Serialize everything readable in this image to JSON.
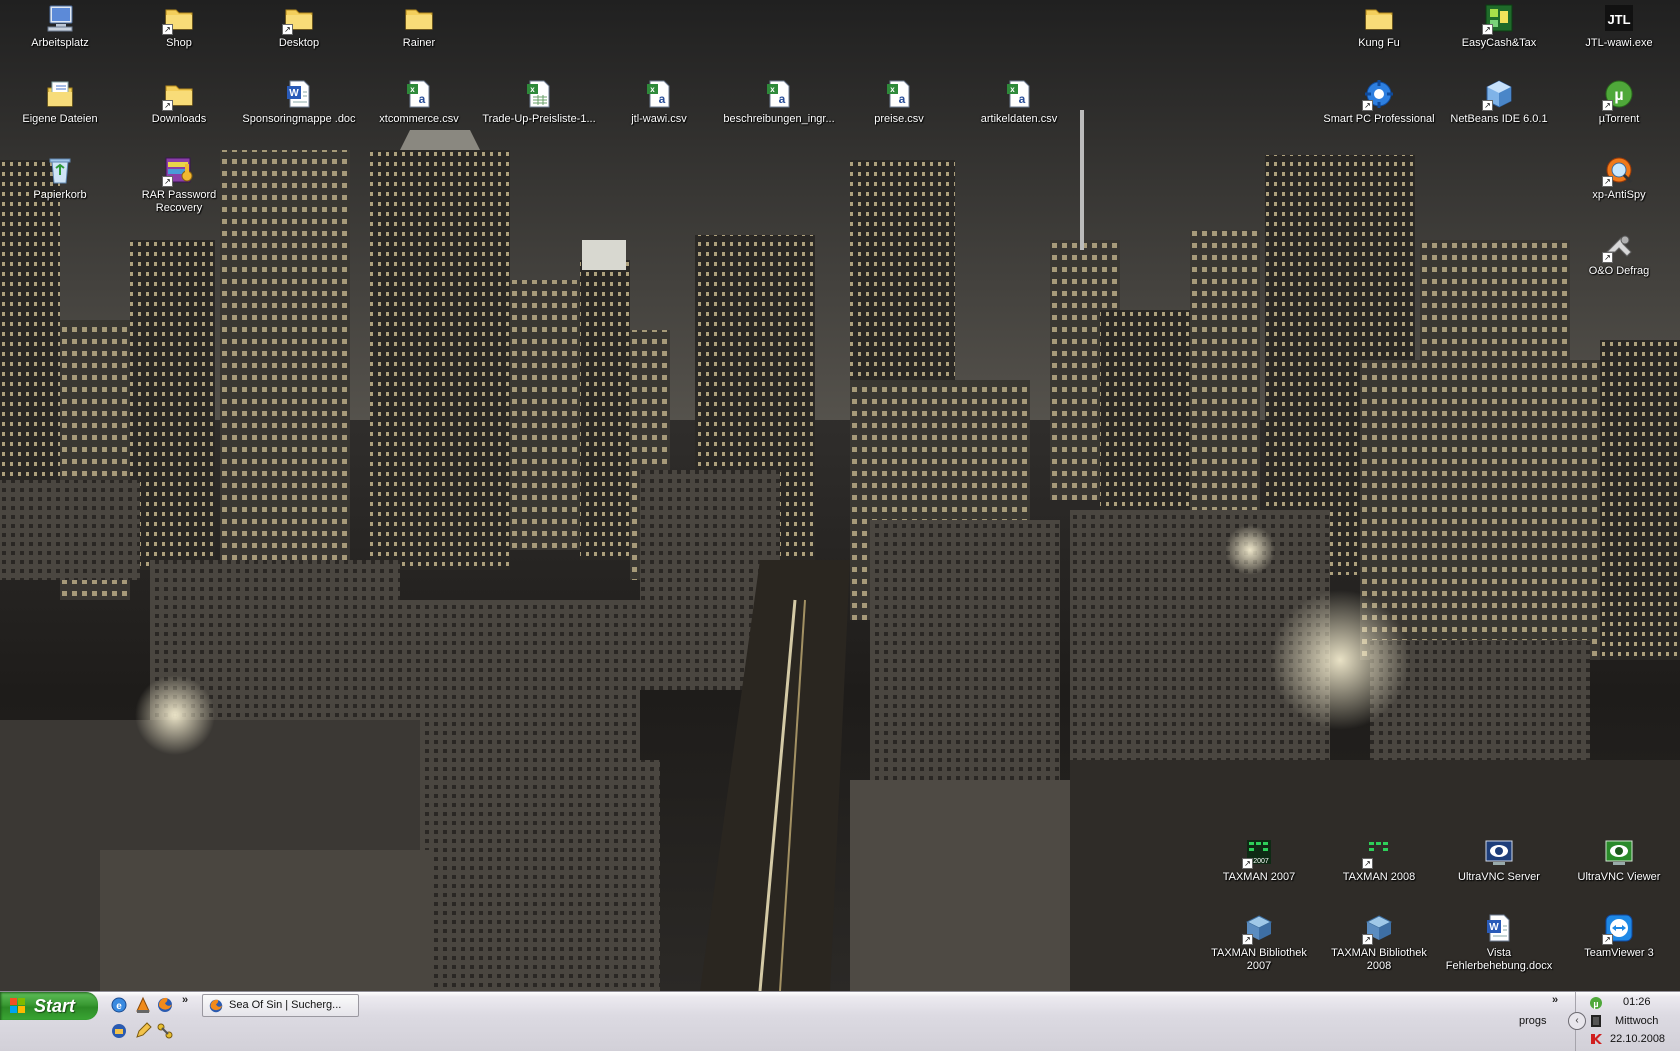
{
  "desktop": {
    "icons": [
      {
        "label": "Arbeitsplatz",
        "icon": "my-computer-icon"
      },
      {
        "label": "Shop",
        "icon": "folder-icon"
      },
      {
        "label": "Desktop",
        "icon": "folder-icon"
      },
      {
        "label": "Rainer",
        "icon": "folder-icon"
      },
      {
        "label": "Kung Fu",
        "icon": "folder-icon"
      },
      {
        "label": "EasyCash&Tax",
        "icon": "easycash-icon"
      },
      {
        "label": "JTL-wawi.exe",
        "icon": "jtl-icon"
      },
      {
        "label": "Eigene Dateien",
        "icon": "my-documents-icon"
      },
      {
        "label": "Downloads",
        "icon": "folder-icon"
      },
      {
        "label": "Sponsoringmappe .doc",
        "icon": "word-document-icon"
      },
      {
        "label": "xtcommerce.csv",
        "icon": "csv-file-icon"
      },
      {
        "label": "Trade-Up-Preisliste-1...",
        "icon": "excel-file-icon"
      },
      {
        "label": "jtl-wawi.csv",
        "icon": "csv-file-icon"
      },
      {
        "label": "beschreibungen_ingr...",
        "icon": "csv-file-icon"
      },
      {
        "label": "preise.csv",
        "icon": "csv-file-icon"
      },
      {
        "label": "artikeldaten.csv",
        "icon": "csv-file-icon"
      },
      {
        "label": "Smart PC Professional",
        "icon": "smart-pc-icon"
      },
      {
        "label": "NetBeans IDE 6.0.1",
        "icon": "netbeans-icon"
      },
      {
        "label": "µTorrent",
        "icon": "utorrent-icon"
      },
      {
        "label": "Papierkorb",
        "icon": "recycle-bin-icon"
      },
      {
        "label": "RAR Password Recovery",
        "icon": "rar-password-icon"
      },
      {
        "label": "xp-AntiSpy",
        "icon": "antispy-icon"
      },
      {
        "label": "O&O Defrag",
        "icon": "defrag-icon"
      },
      {
        "label": "TAXMAN 2007",
        "icon": "taxman-icon"
      },
      {
        "label": "TAXMAN 2008",
        "icon": "taxman-icon"
      },
      {
        "label": "UltraVNC Server",
        "icon": "ultravnc-server-icon"
      },
      {
        "label": "UltraVNC Viewer",
        "icon": "ultravnc-viewer-icon"
      },
      {
        "label": "TAXMAN Bibliothek 2007",
        "icon": "taxman-library-icon"
      },
      {
        "label": "TAXMAN Bibliothek 2008",
        "icon": "taxman-library-icon"
      },
      {
        "label": "Vista Fehlerbehebung.docx",
        "icon": "word-document-icon"
      },
      {
        "label": "TeamViewer 3",
        "icon": "teamviewer-icon"
      }
    ]
  },
  "taskbar": {
    "start_label": "Start",
    "quick_launch": [
      "ie-icon",
      "vlc-icon",
      "firefox-icon",
      "thunderbird-icon",
      "pencil-icon",
      "network-icon"
    ],
    "quick_launch_more": "»",
    "task_button_label": "Sea Of Sin | Sucherg...",
    "toolbar_more": "»",
    "toolbar_label": "progs",
    "tray_icons": [
      "utorrent-tray-icon",
      "monitor-tray-icon",
      "kaspersky-tray-icon"
    ],
    "clock_time": "01:26",
    "clock_day": "Mittwoch",
    "clock_date": "22.10.2008"
  }
}
